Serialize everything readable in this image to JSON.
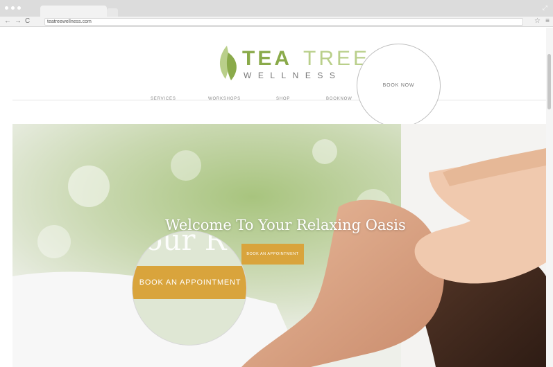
{
  "browser": {
    "url": "teatreewellness.com",
    "icons": {
      "back": "back-arrow-icon",
      "forward": "forward-arrow-icon",
      "reload": "reload-icon",
      "bookmark": "star-icon",
      "menu": "menu-icon"
    }
  },
  "logo": {
    "tea": "TEA",
    "tree": "TREE",
    "wellness": "WELLNESS"
  },
  "nav": {
    "services": "SERVICES",
    "workshops": "WORKSHOPS",
    "shop": "SHOP",
    "booknow": "BOOKNOW"
  },
  "book_now_circle": "BOOK NOW",
  "hero": {
    "title": "Welcome To Your Relaxing Oasis",
    "button": "BOOK AN APPOINTMENT",
    "magnified_text": "our R",
    "magnified_button": "BOOK AN APPOINTMENT"
  },
  "colors": {
    "accent_gold": "#d9a43c",
    "logo_green_dark": "#8aaa4a",
    "logo_green_light": "#b9cf8a"
  }
}
